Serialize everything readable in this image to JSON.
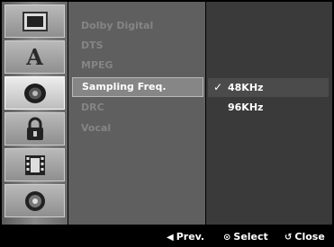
{
  "sidebar": {
    "items": [
      {
        "icon": "tv-screen-icon"
      },
      {
        "icon": "language-a-icon",
        "glyph": "A"
      },
      {
        "icon": "audio-speaker-icon",
        "active": true
      },
      {
        "icon": "lock-icon"
      },
      {
        "icon": "film-icon"
      },
      {
        "icon": "disc-icon"
      }
    ]
  },
  "menu": {
    "items": [
      {
        "label": "Dolby Digital"
      },
      {
        "label": "DTS"
      },
      {
        "label": "MPEG"
      },
      {
        "label": "Sampling Freq.",
        "active": true
      },
      {
        "label": "DRC"
      },
      {
        "label": "Vocal"
      }
    ]
  },
  "options": {
    "check_glyph": "✓",
    "items": [
      {
        "label": "48KHz",
        "selected": true
      },
      {
        "label": "96KHz",
        "selected": false
      }
    ]
  },
  "hints": {
    "prev": {
      "glyph": "◀",
      "label": "Prev."
    },
    "select": {
      "glyph": "⊙",
      "label": "Select"
    },
    "close": {
      "glyph": "↺",
      "label": "Close"
    }
  },
  "colors": {
    "menu_bg": "#5f5f5f",
    "options_bg": "#3a3a3a",
    "highlight": "#868686",
    "dim_text": "#858585"
  }
}
